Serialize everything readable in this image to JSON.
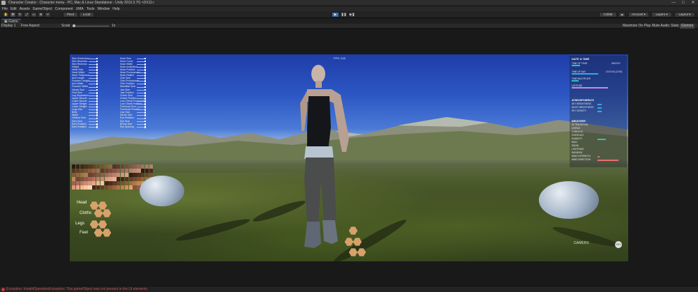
{
  "window": {
    "title": "Character Creator - Character menu - PC, Mac & Linux Standalone - Unity 2019.3.7f1 <DX11>",
    "controls": [
      "—",
      "□",
      "✕"
    ]
  },
  "menu": [
    "File",
    "Edit",
    "Assets",
    "GameObject",
    "Component",
    "UMA",
    "Tools",
    "Window",
    "Help"
  ],
  "toolbar": {
    "pivot_label": "Pivot",
    "local_label": "Local",
    "collab_label": "Collab",
    "account_label": "Account",
    "layers_label": "Layers",
    "layout_label": "Layout",
    "play_icon": "▶",
    "pause_icon": "❚❚",
    "step_icon": "▶❚"
  },
  "tabs": {
    "game": "Game"
  },
  "gameview": {
    "display": "Display 1",
    "aspect": "Free Aspect",
    "scale_label": "Scale",
    "scale_value": "1x",
    "maximize": "Maximize On Play",
    "mute": "Mute Audio",
    "stats": "Stats",
    "gizmos": "Gizmos"
  },
  "hud": {
    "fps": "FPS: 218",
    "sliders_left": [
      "Skin Greenness",
      "Skin Blueness",
      "Skin Redness",
      "Height",
      "Head Size",
      "Head Width",
      "Neck Thickness",
      "Arm Length",
      "Forearm Length",
      "Arm Width",
      "Forearm Width",
      "Hands Size",
      "Feet Size",
      "Leg Separation",
      "Upper Muscle",
      "Lower Muscle",
      "Upper Weight",
      "Lower Weight",
      "Legs Size",
      "Belly",
      "Waist",
      "Gluteus Size",
      "Ears Size",
      "Ears Position",
      "Ears Rotation"
    ],
    "sliders_right": [
      "Nose Size",
      "Nose Curve",
      "Nose Width",
      "Nose Inclination",
      "Nose Position",
      "Nose Pronounced",
      "Nose Flatten",
      "Chin Size",
      "Chin Pronounced",
      "Chin Position",
      "Mandible Size",
      "Jaw Size",
      "Jaw Position",
      "Cheek Size",
      "Cheek Position",
      "Low Cheek Pronounced",
      "Low Cheek Position",
      "Forehead Size",
      "Forehead Position",
      "Lips Size",
      "Mouth Size",
      "Eye Rotation",
      "Eye Size",
      "Brows Size",
      "Eye Spacing"
    ],
    "hex_labels": [
      "Head",
      "Cloths",
      "Legs",
      "Feet"
    ],
    "palette_colors": [
      "#3a2418",
      "#4a2c1c",
      "#5a3822",
      "#6b4428",
      "#7a5030",
      "#8a5c38",
      "#9a6a40",
      "#a87848",
      "#b88650",
      "#c69460",
      "#7a4a3a",
      "#8a5444",
      "#9a604e",
      "#aa6c58",
      "#ba7a62",
      "#c8886e",
      "#d6967a",
      "#e0a486",
      "#eab294",
      "#f2c0a2"
    ],
    "logo_text": "GAMERS",
    "logo_badge": "DEV"
  },
  "weather": {
    "date_header": "DATE & TIME",
    "date_rows": [
      "TIME OF YEAR",
      "TIME OF DAY",
      "TIME MULTIPLIER",
      "LATITUDE"
    ],
    "date_values": [
      "04/02/19",
      "10:23:44 (12:00)",
      "",
      ""
    ],
    "atmo_header": "ATMOSPHERICS",
    "atmo_rows": [
      "SKY BRIGHTNESS",
      "NIGHT BRIGHTNESS",
      "SKY DENSITY"
    ],
    "weather_header": "WEATHER",
    "weather_rows": [
      "IN TRANSITION",
      "CIRRUS",
      "CUMULUS",
      "OVERCAST",
      "HUMIDITY",
      "RAIN",
      "SNOW",
      "LIGHTNING",
      "RAINBOW",
      "WIND STRENGTH",
      "WIND DIRECTION"
    ],
    "colors": {
      "teal": "#2fc0c0",
      "pink": "#e87070",
      "purple": "#c58ae6",
      "blue": "#3aa8e0"
    }
  },
  "status": {
    "message": "Exception: InvalidOperationException: This gameObject was not present in the UI elements"
  },
  "colors": {
    "accent": "#3b6fb0",
    "error": "#c23a3a"
  }
}
